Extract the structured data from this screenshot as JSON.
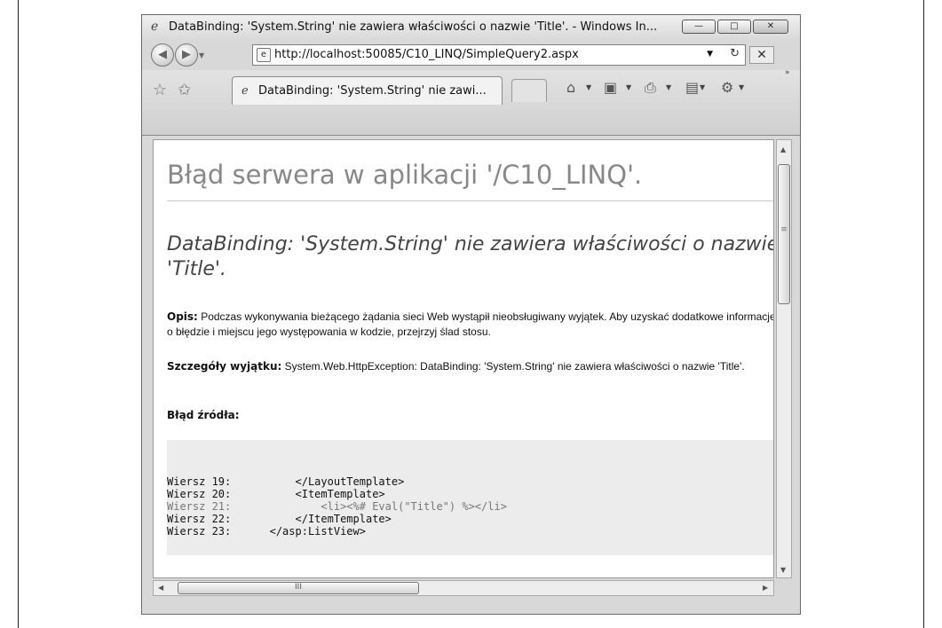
{
  "window": {
    "title": "DataBinding: 'System.String' nie zawiera właściwości o nazwie 'Title'. - Windows In...",
    "address": "http://localhost:50085/C10_LINQ/SimpleQuery2.aspx",
    "tab_label": "DataBinding: 'System.String' nie zawi...",
    "buttons": {
      "min": "—",
      "max": "□",
      "close": "✕",
      "stop": "✕",
      "refresh": "↻",
      "dropdown": "▼"
    }
  },
  "page": {
    "heading": "Błąd serwera w aplikacji '/C10_LINQ'.",
    "error_title": "DataBinding: 'System.String' nie zawiera właściwości o nazwie 'Title'.",
    "opis_label": "Opis:",
    "opis_text": " Podczas wykonywania bieżącego żądania sieci Web wystąpił nieobsługiwany wyjątek. Aby uzyskać dodatkowe informacje o błędzie i miejscu jego występowania w kodzie, przejrzyj ślad stosu.",
    "details_label": "Szczegóły wyjątku:",
    "details_text": " System.Web.HttpException: DataBinding: 'System.String' nie zawiera właściwości o nazwie 'Title'.",
    "source_label": "Błąd źródła:",
    "code_lines": [
      {
        "num": "Wiersz 19:",
        "code": "        </LayoutTemplate>"
      },
      {
        "num": "Wiersz 20:",
        "code": "        <ItemTemplate>"
      },
      {
        "num": "Wiersz 21:",
        "code": "            <li><%# Eval(\"Title\") %></li>"
      },
      {
        "num": "Wiersz 22:",
        "code": "        </ItemTemplate>"
      },
      {
        "num": "Wiersz 23:",
        "code": "    </asp:ListView>"
      }
    ]
  },
  "icons": [
    "ie-icon",
    "back-icon",
    "forward-icon",
    "favorites-star-icon",
    "add-favorites-icon",
    "home-icon",
    "feeds-icon",
    "print-icon",
    "page-icon",
    "tools-icon"
  ]
}
